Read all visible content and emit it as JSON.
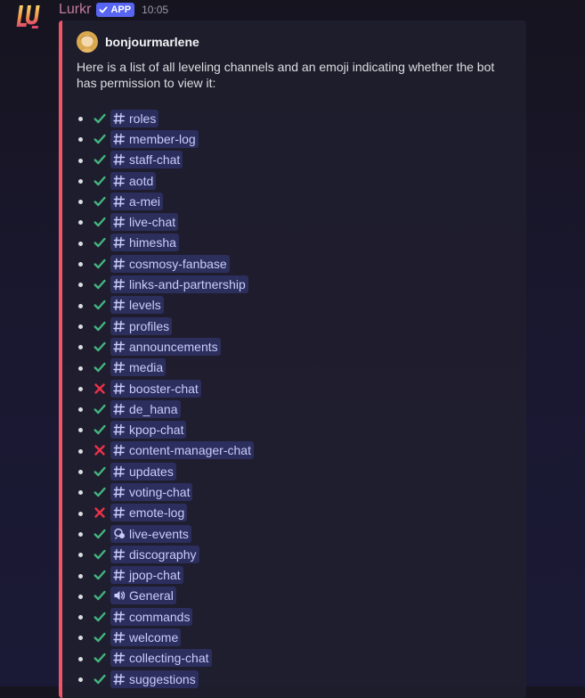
{
  "message": {
    "author": "Lurkr",
    "badge": "APP",
    "timestamp": "10:05"
  },
  "embed": {
    "accent_color": "#f0566a",
    "author_name": "bonjourmarlene",
    "description": "Here is a list of all leveling channels and an emoji indicating whether the bot has permission to view it:",
    "channels": [
      {
        "name": "roles",
        "allowed": true,
        "icon": "hash-icon"
      },
      {
        "name": "member-log",
        "allowed": true,
        "icon": "hash-icon"
      },
      {
        "name": "staff-chat",
        "allowed": true,
        "icon": "hash-icon"
      },
      {
        "name": "aotd",
        "allowed": true,
        "icon": "hash-icon"
      },
      {
        "name": "a-mei",
        "allowed": true,
        "icon": "hash-icon"
      },
      {
        "name": "live-chat",
        "allowed": true,
        "icon": "hash-icon"
      },
      {
        "name": "himesha",
        "allowed": true,
        "icon": "hash-icon"
      },
      {
        "name": "cosmosy-fanbase",
        "allowed": true,
        "icon": "hash-icon"
      },
      {
        "name": "links-and-partnership",
        "allowed": true,
        "icon": "hash-icon"
      },
      {
        "name": "levels",
        "allowed": true,
        "icon": "hash-icon"
      },
      {
        "name": "profiles",
        "allowed": true,
        "icon": "hash-icon"
      },
      {
        "name": "announcements",
        "allowed": true,
        "icon": "hash-icon"
      },
      {
        "name": "media",
        "allowed": true,
        "icon": "hash-icon"
      },
      {
        "name": "booster-chat",
        "allowed": false,
        "icon": "hash-icon"
      },
      {
        "name": "de_hana",
        "allowed": true,
        "icon": "hash-icon"
      },
      {
        "name": "kpop-chat",
        "allowed": true,
        "icon": "hash-icon"
      },
      {
        "name": "content-manager-chat",
        "allowed": false,
        "icon": "hash-icon"
      },
      {
        "name": "updates",
        "allowed": true,
        "icon": "hash-icon"
      },
      {
        "name": "voting-chat",
        "allowed": true,
        "icon": "hash-icon"
      },
      {
        "name": "emote-log",
        "allowed": false,
        "icon": "hash-icon"
      },
      {
        "name": "live-events",
        "allowed": true,
        "icon": "stage-icon"
      },
      {
        "name": "discography",
        "allowed": true,
        "icon": "hash-icon"
      },
      {
        "name": "jpop-chat",
        "allowed": true,
        "icon": "hash-icon"
      },
      {
        "name": "General",
        "allowed": true,
        "icon": "speaker-icon"
      },
      {
        "name": "commands",
        "allowed": true,
        "icon": "hash-icon"
      },
      {
        "name": "welcome",
        "allowed": true,
        "icon": "hash-icon"
      },
      {
        "name": "collecting-chat",
        "allowed": true,
        "icon": "hash-icon"
      },
      {
        "name": "suggestions",
        "allowed": true,
        "icon": "hash-icon"
      }
    ]
  },
  "colors": {
    "check": "#43b581",
    "cross": "#e8334a",
    "mention_text": "#c9cdfb",
    "username": "#c27c9d",
    "badge_bg": "#5865f2"
  }
}
